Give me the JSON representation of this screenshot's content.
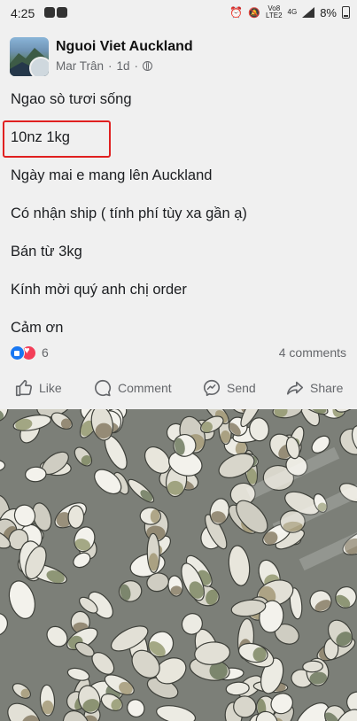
{
  "status_bar": {
    "time": "4:25",
    "network_top": "Vo8",
    "network_bottom": "LTE2",
    "network_gen": "4G",
    "battery": "8%"
  },
  "post": {
    "group_name": "Nguoi Viet Auckland",
    "author": "Mar Trân",
    "separator": "·",
    "time_ago": "1d",
    "separator2": "·",
    "lines": [
      "Ngao sò tươi sống",
      "10nz 1kg",
      "Ngày mai e mang lên Auckland",
      "Có nhận ship ( tính phí tùy xa gần ạ)",
      "Bán từ 3kg",
      "Kính mời quý anh chị order",
      "Cảm ơn"
    ],
    "reaction_count": "6",
    "comments_label": "4 comments",
    "highlight_color": "#e02020"
  },
  "actions": {
    "like": "Like",
    "comment": "Comment",
    "send": "Send",
    "share": "Share"
  },
  "colors": {
    "like_blue": "#1877f2",
    "love_red": "#f33e58",
    "secondary_text": "#65676b"
  }
}
